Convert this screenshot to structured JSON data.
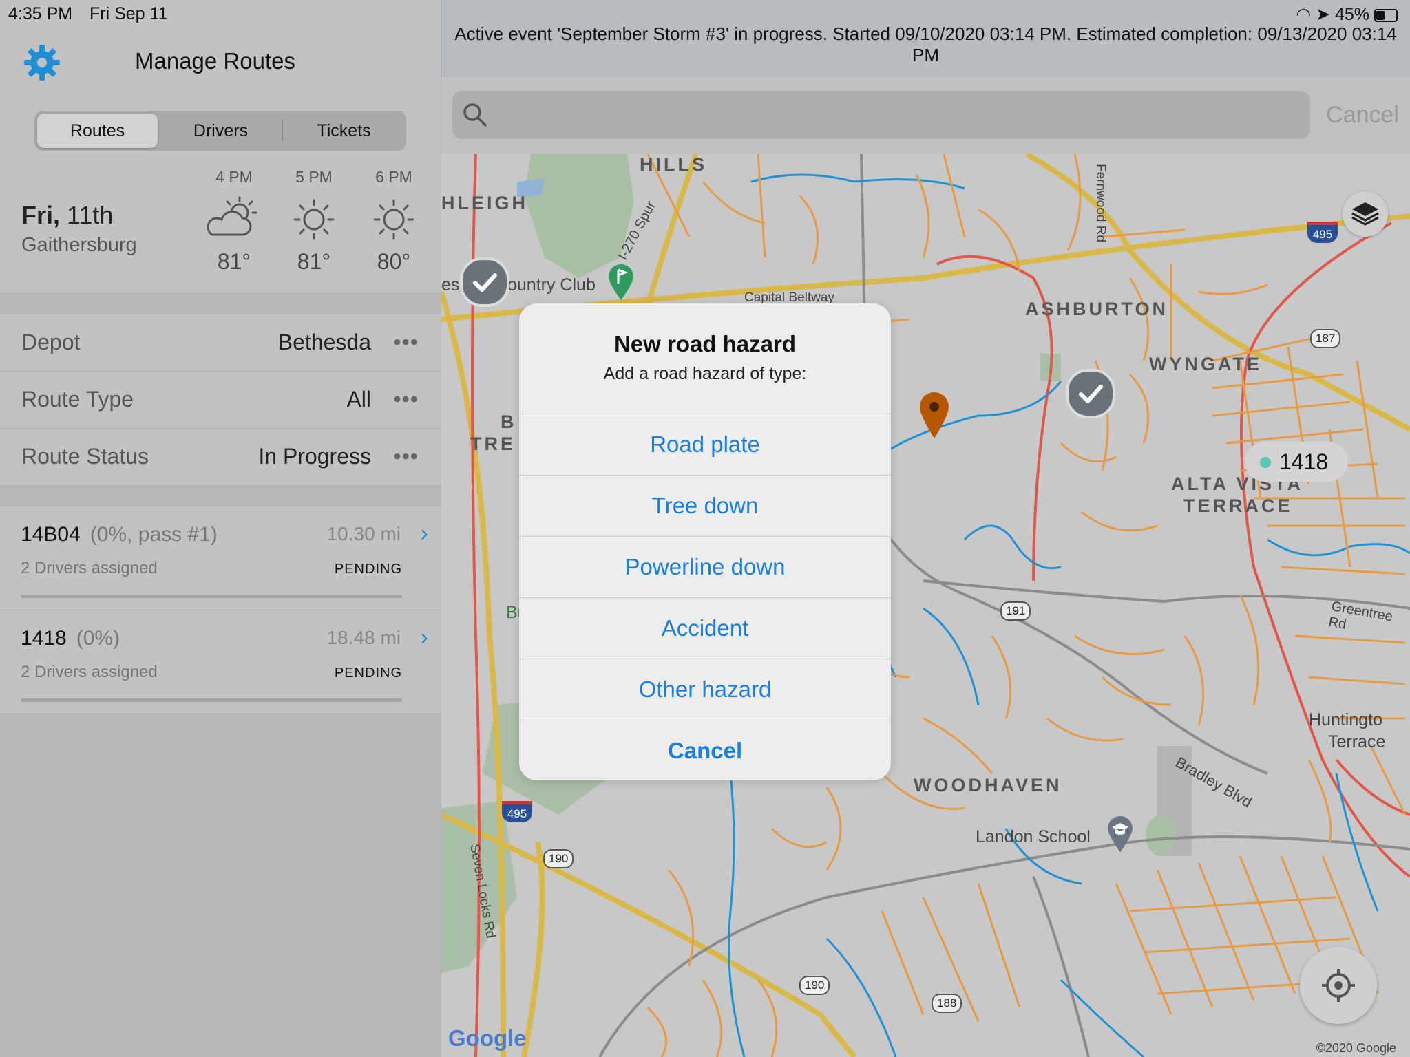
{
  "status_bar": {
    "time": "4:35 PM",
    "date": "Fri Sep 11",
    "battery": "45%"
  },
  "left": {
    "title": "Manage Routes",
    "tabs": [
      {
        "label": "Routes"
      },
      {
        "label": "Drivers"
      },
      {
        "label": "Tickets"
      }
    ],
    "weather": {
      "day": "Fri,",
      "date": "11th",
      "city": "Gaithersburg",
      "hours": [
        {
          "time": "4 PM",
          "temp": "81°",
          "icon": "partly-cloudy-icon"
        },
        {
          "time": "5 PM",
          "temp": "81°",
          "icon": "sun-icon"
        },
        {
          "time": "6 PM",
          "temp": "80°",
          "icon": "sun-icon"
        }
      ]
    },
    "filters": [
      {
        "label": "Depot",
        "value": "Bethesda",
        "more": "•••"
      },
      {
        "label": "Route Type",
        "value": "All",
        "more": "•••"
      },
      {
        "label": "Route Status",
        "value": "In Progress",
        "more": "•••"
      }
    ],
    "routes": [
      {
        "name": "14B04",
        "pct": "(0%, pass #1)",
        "miles": "10.30 mi",
        "drivers": "2 Drivers assigned",
        "status": "PENDING",
        "progress": 0
      },
      {
        "name": "1418",
        "pct": "(0%)",
        "miles": "18.48 mi",
        "drivers": "2 Drivers assigned",
        "status": "PENDING",
        "progress": 0
      }
    ]
  },
  "banner": "Active event 'September Storm #3' in progress. Started 09/10/2020 03:14 PM. Estimated completion: 09/13/2020 03:14 PM",
  "search": {
    "placeholder": "",
    "cancel": "Cancel"
  },
  "map": {
    "labels": {
      "hills": "HILLS",
      "leigh": "HLEIGH",
      "country_club": "ountry Club",
      "ashburton": "ASHBURTON",
      "wyngate": "WYNGATE",
      "alta_vista": "ALTA VISTA",
      "terrace": "TERRACE",
      "woodhaven": "WOODHAVEN",
      "landon": "Landon School",
      "huntington": "Huntingto",
      "huntington2": "Terrace",
      "bradley": "Bradley Blvd",
      "greentree": "Greentree Rd",
      "fernwood": "Fernwood Rd",
      "spur": "I-270 Spur",
      "seven_locks": "Seven Locks Rd",
      "tre": "TRE",
      "b": "B",
      "bu": "Bu",
      "es": "es",
      "capital": "Capital Beltway"
    },
    "shields": {
      "i495a": "495",
      "i495b": "495",
      "r187": "187",
      "r191": "191",
      "r190a": "190",
      "r190b": "190",
      "r188": "188"
    },
    "route_pill": "1418",
    "copyright": "©2020 Google",
    "google": "Google"
  },
  "dialog": {
    "title": "New road hazard",
    "message": "Add a road hazard of type:",
    "options": [
      "Road plate",
      "Tree down",
      "Powerline down",
      "Accident",
      "Other hazard"
    ],
    "cancel": "Cancel"
  }
}
